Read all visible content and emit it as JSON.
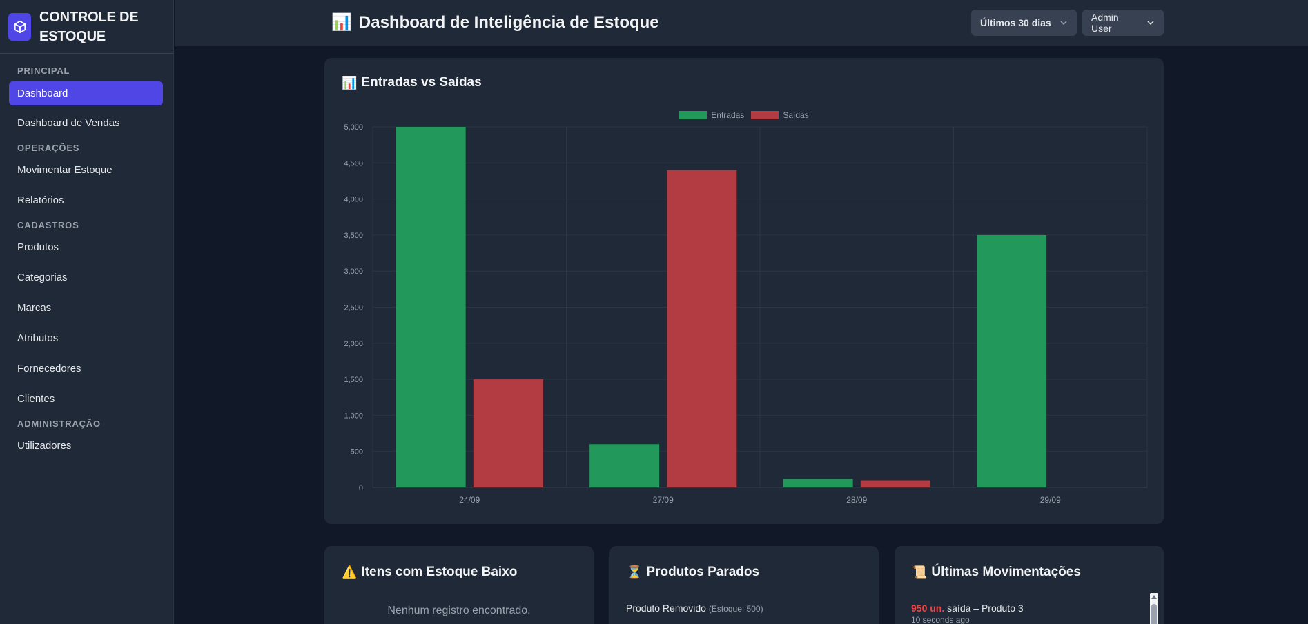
{
  "brand": {
    "line1": "CONTROLE DE",
    "line2": "ESTOQUE"
  },
  "sidebar": {
    "sections": [
      {
        "label": "PRINCIPAL"
      },
      {
        "label": "OPERAÇÕES"
      },
      {
        "label": "CADASTROS"
      },
      {
        "label": "ADMINISTRAÇÃO"
      }
    ],
    "items": [
      {
        "label": "Dashboard",
        "active": true
      },
      {
        "label": "Dashboard de Vendas"
      },
      {
        "label": "Movimentar Estoque"
      },
      {
        "label": "Relatórios"
      },
      {
        "label": "Produtos"
      },
      {
        "label": "Categorias"
      },
      {
        "label": "Marcas"
      },
      {
        "label": "Atributos"
      },
      {
        "label": "Fornecedores"
      },
      {
        "label": "Clientes"
      },
      {
        "label": "Utilizadores"
      }
    ]
  },
  "header": {
    "title": "Dashboard de Inteligência de Estoque",
    "title_emoji": "📊",
    "period_label": "Últimos 30 dias",
    "user_label": "Admin User"
  },
  "chart_card": {
    "title": "Entradas vs Saídas",
    "emoji": "📊"
  },
  "chart_data": {
    "type": "bar",
    "categories": [
      "24/09",
      "27/09",
      "28/09",
      "29/09"
    ],
    "series": [
      {
        "name": "Entradas",
        "color": "#22995a",
        "values": [
          5000,
          600,
          120,
          3500
        ]
      },
      {
        "name": "Saídas",
        "color": "#b33b42",
        "values": [
          1500,
          4400,
          100,
          0
        ]
      }
    ],
    "ylim": [
      0,
      5000
    ],
    "yticks": [
      "0",
      "500",
      "1,000",
      "1,500",
      "2,000",
      "2,500",
      "3,000",
      "3,500",
      "4,000",
      "4,500",
      "5,000"
    ],
    "legend": "top-center",
    "grid": true
  },
  "low_stock": {
    "title": "Itens com Estoque Baixo",
    "emoji": "⚠️",
    "empty": "Nenhum registro encontrado."
  },
  "stalled": {
    "title": "Produtos Parados",
    "emoji": "⏳",
    "item_name": "Produto Removido",
    "item_sub": "(Estoque: 500)"
  },
  "movements": {
    "title": "Últimas Movimentações",
    "emoji": "📜",
    "qty": "950 un.",
    "desc": " saída – Produto 3",
    "time": "10 seconds ago"
  }
}
